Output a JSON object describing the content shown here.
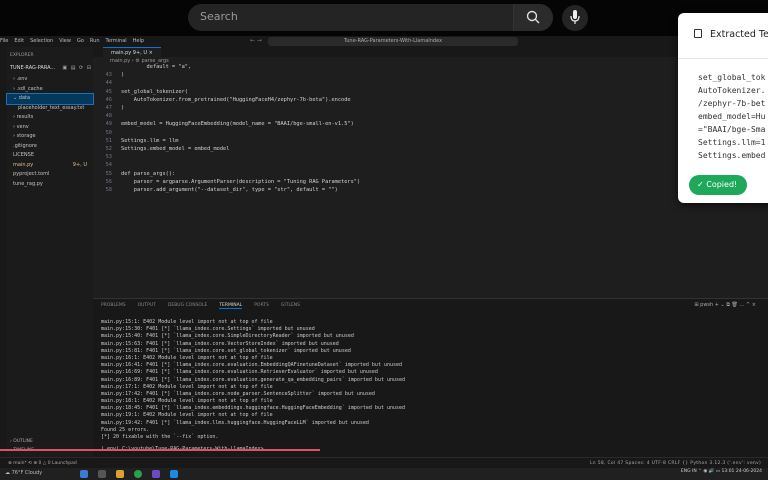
{
  "browser": {
    "search_placeholder": "Search"
  },
  "vscode": {
    "menu": [
      "File",
      "Edit",
      "Selection",
      "View",
      "Go",
      "Run",
      "Terminal",
      "Help"
    ],
    "command_center": "Tune-RAG-Parameters-With-LlamaIndex",
    "sidebar": {
      "header": "EXPLORER",
      "project": "TUNE-RAG-PARA...",
      "items": [
        {
          "label": "› .env"
        },
        {
          "label": "› .sdl_cache"
        },
        {
          "label": "⌄ data",
          "selected": true
        },
        {
          "label": "placeholder_text_essay.txt",
          "child": true
        },
        {
          "label": "› results"
        },
        {
          "label": "› venv"
        },
        {
          "label": "› storage"
        },
        {
          "label": ".gitignore"
        },
        {
          "label": "LICENSE"
        },
        {
          "label": "main.py",
          "badge": "9+, U"
        },
        {
          "label": "pyproject.toml"
        },
        {
          "label": "tune_rag.py"
        }
      ],
      "outline": "› OUTLINE",
      "timeline": "› TIMELINE"
    },
    "tab": "main.py  9+, U  ×",
    "breadcrumb": "main.py › ⚙ parse_args",
    "code_lines": [
      {
        "n": "",
        "t": "        default = \"a\","
      },
      {
        "n": "43",
        "t": ")"
      },
      {
        "n": "44",
        "t": ""
      },
      {
        "n": "45",
        "t": "set_global_tokenizer("
      },
      {
        "n": "46",
        "t": "    AutoTokenizer.from_pretrained(\"HuggingFaceH4/zephyr-7b-beta\").encode"
      },
      {
        "n": "47",
        "t": ")"
      },
      {
        "n": "48",
        "t": ""
      },
      {
        "n": "49",
        "t": "embed_model = HuggingFaceEmbedding(model_name = \"BAAI/bge-small-en-v1.5\")"
      },
      {
        "n": "50",
        "t": ""
      },
      {
        "n": "51",
        "t": "Settings.llm = llm"
      },
      {
        "n": "52",
        "t": "Settings.embed_model = embed_model"
      },
      {
        "n": "53",
        "t": ""
      },
      {
        "n": "54",
        "t": ""
      },
      {
        "n": "55",
        "t": "def parse_args():"
      },
      {
        "n": "56",
        "t": "    parser = argparse.ArgumentParser(description = \"Tuning RAG Parameters\")"
      },
      {
        "n": "58",
        "t": "    parser.add_argument(\"--dataset_dir\", type = \"str\", default = \"\")"
      }
    ],
    "panel_tabs": [
      "PROBLEMS",
      "OUTPUT",
      "DEBUG CONSOLE",
      "TERMINAL",
      "PORTS",
      "GITLENS"
    ],
    "panel_tools": "⊞ pwsh  +  ⌄  ⧉  🗑  …  ^  ×",
    "terminal_lines": [
      "main.py:15:1: E402 Module level import not at top of file",
      "main.py:15:30: F401 [*] `llama_index.core.Settings` imported but unused",
      "main.py:15:40: F401 [*] `llama_index.core.SimpleDirectoryReader` imported but unused",
      "main.py:15:63: F401 [*] `llama_index.core.VectorStoreIndex` imported but unused",
      "main.py:15:81: F401 [*] `llama_index.core.set_global_tokenizer` imported but unused",
      "main.py:16:1: E402 Module level import not at top of file",
      "main.py:16:41: F401 [*] `llama_index.core.evaluation.EmbeddingQAFinetuneDataset` imported but unused",
      "main.py:16:69: F401 [*] `llama_index.core.evaluation.RetrieverEvaluator` imported but unused",
      "main.py:16:89: F401 [*] `llama_index.core.evaluation.generate_qa_embedding_pairs` imported but unused",
      "main.py:17:1: E402 Module level import not at top of file",
      "main.py:17:42: F401 [*] `llama_index.core.node_parser.SentenceSplitter` imported but unused",
      "main.py:18:1: E402 Module level import not at top of file",
      "main.py:18:45: F401 [*] `llama_index.embeddings.huggingface.HuggingFaceEmbedding` imported but unused",
      "main.py:19:1: E402 Module level import not at top of file",
      "main.py:19:42: F401 [*] `llama_index.llms.huggingface.HuggingFaceLLM` imported but unused",
      "Found 25 errors.",
      "[*] 20 fixable with the `--fix` option."
    ],
    "prompt": "(.env) C:\\youtube\\Tune-RAG-Parameters-With-LlamaIndex>",
    "status_left": "⊗ main*  ⟲  ⊗ 0 △ 0  Launchpad",
    "status_right": "Ln 58, Col 47   Spaces: 4   UTF-8   CRLF   {} Python   3.12.3 ('.env': venv)"
  },
  "taskbar": {
    "weather": "☁ 76°F  Cloudy",
    "tray": "ENG IN  ⌃  ◉  🔊  ▭   13:01 24-06-2024"
  },
  "popup": {
    "title": "Extracted Text",
    "text_lines": [
      "set_global_tok",
      "AutoTokenizer.",
      "/zephyr-7b-bet",
      "embed_model=Hu",
      "=\"BAAI/bge-Sma",
      "Settings.llm=1",
      "Settings.embed"
    ],
    "copied_label": "✓  Copied!"
  }
}
